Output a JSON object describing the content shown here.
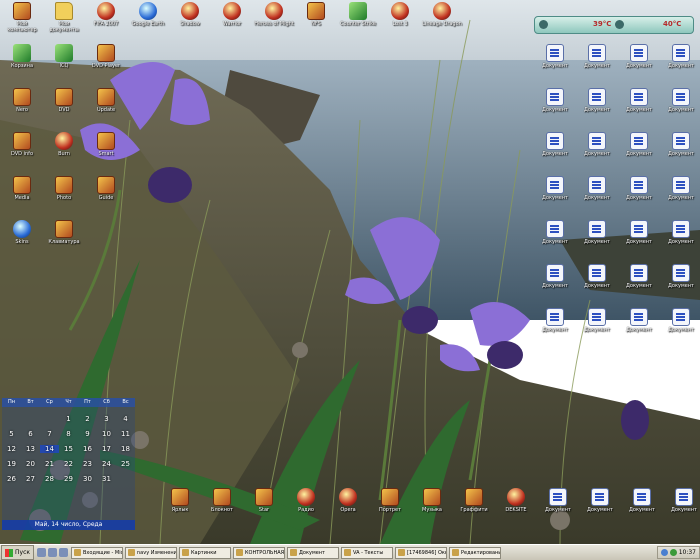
{
  "desktop": {
    "top_row": [
      {
        "label": "Мой компьютер",
        "icon": "computer-icon",
        "kind": "app"
      },
      {
        "label": "Мои документы",
        "icon": "folder-icon",
        "kind": "folder"
      },
      {
        "label": "FIFA 2007",
        "icon": "game-icon",
        "kind": "game"
      },
      {
        "label": "Google Earth",
        "icon": "globe-icon",
        "kind": "blue"
      },
      {
        "label": "Shadow",
        "icon": "game-icon",
        "kind": "game"
      },
      {
        "label": "Warrior",
        "icon": "game-icon",
        "kind": "game"
      },
      {
        "label": "Heroes of Might",
        "icon": "game-icon",
        "kind": "game"
      },
      {
        "label": "NFS",
        "icon": "game-icon",
        "kind": "app"
      },
      {
        "label": "Counter Strike",
        "icon": "game-icon",
        "kind": "green"
      },
      {
        "label": "Lost 3",
        "icon": "game-icon",
        "kind": "game"
      },
      {
        "label": "Lineage Dragon",
        "icon": "game-icon",
        "kind": "game"
      }
    ],
    "left_column": [
      {
        "label": "Корзина",
        "kind": "green"
      },
      {
        "label": "ICQ",
        "kind": "green"
      },
      {
        "label": "DVD Player",
        "kind": "app"
      },
      {
        "label": "Nero",
        "kind": "app"
      },
      {
        "label": "DVD",
        "kind": "app"
      },
      {
        "label": "Update",
        "kind": "app"
      },
      {
        "label": "DVD info",
        "kind": "app"
      },
      {
        "label": "Burn",
        "kind": "game"
      },
      {
        "label": "Smart",
        "kind": "app"
      },
      {
        "label": "Media",
        "kind": "app"
      },
      {
        "label": "Photo",
        "kind": "app"
      },
      {
        "label": "Guide",
        "kind": "app"
      },
      {
        "label": "Skins",
        "kind": "blue"
      },
      {
        "label": "Клавиатура",
        "kind": "app"
      }
    ],
    "right_grid": [
      {
        "label": "Документ"
      },
      {
        "label": "Документ"
      },
      {
        "label": "Документ"
      },
      {
        "label": "Документ"
      },
      {
        "label": "Документ"
      },
      {
        "label": "Документ"
      },
      {
        "label": "Документ"
      },
      {
        "label": "Документ"
      },
      {
        "label": "Документ"
      },
      {
        "label": "Документ"
      },
      {
        "label": "Документ"
      },
      {
        "label": "Документ"
      },
      {
        "label": "Документ"
      },
      {
        "label": "Документ"
      },
      {
        "label": "Документ"
      },
      {
        "label": "Документ"
      },
      {
        "label": "Документ"
      },
      {
        "label": "Документ"
      },
      {
        "label": "Документ"
      },
      {
        "label": "Документ"
      },
      {
        "label": "Документ"
      },
      {
        "label": "Документ"
      },
      {
        "label": "Документ"
      },
      {
        "label": "Документ"
      },
      {
        "label": "Документ"
      },
      {
        "label": "Документ"
      },
      {
        "label": "Документ"
      },
      {
        "label": "Документ"
      }
    ],
    "bottom_row": [
      {
        "label": "Ярлык",
        "kind": "app"
      },
      {
        "label": "Блокнот",
        "kind": "app"
      },
      {
        "label": "Star",
        "kind": "app"
      },
      {
        "label": "Радио",
        "kind": "game"
      },
      {
        "label": "Opera",
        "kind": "game"
      },
      {
        "label": "Портрет",
        "kind": "app"
      },
      {
        "label": "Музыка",
        "kind": "app"
      },
      {
        "label": "Граффити",
        "kind": "app"
      },
      {
        "label": "DEKSITE",
        "kind": "game"
      },
      {
        "label": "Документ",
        "kind": "doc"
      },
      {
        "label": "Документ",
        "kind": "doc"
      },
      {
        "label": "Документ",
        "kind": "doc"
      },
      {
        "label": "Документ",
        "kind": "doc"
      }
    ]
  },
  "weather_gadget": {
    "temp_left": "39°C",
    "temp_right": "40°C"
  },
  "calendar": {
    "weekdays": [
      "Пн",
      "Вт",
      "Ср",
      "Чт",
      "Пт",
      "Сб",
      "Вс"
    ],
    "days": [
      "",
      "",
      "",
      "1",
      "2",
      "3",
      "4",
      "5",
      "6",
      "7",
      "8",
      "9",
      "10",
      "11",
      "12",
      "13",
      "14",
      "15",
      "16",
      "17",
      "18",
      "19",
      "20",
      "21",
      "22",
      "23",
      "24",
      "25",
      "26",
      "27",
      "28",
      "29",
      "30",
      "31",
      ""
    ],
    "today": "14",
    "footer": "Май, 14 число, Среда"
  },
  "taskbar": {
    "start_label": "Пуск",
    "tasks": [
      {
        "label": "Входящие - Microsoft"
      },
      {
        "label": "navy Изменения Blog"
      },
      {
        "label": "Картинки"
      },
      {
        "label": "КОНТРОЛЬНАЯ ДЛ"
      },
      {
        "label": "Документ"
      },
      {
        "label": "VA - Тексты"
      },
      {
        "label": "[17469846] Окно"
      },
      {
        "label": "Редактирование"
      }
    ],
    "clock": "10:37"
  }
}
